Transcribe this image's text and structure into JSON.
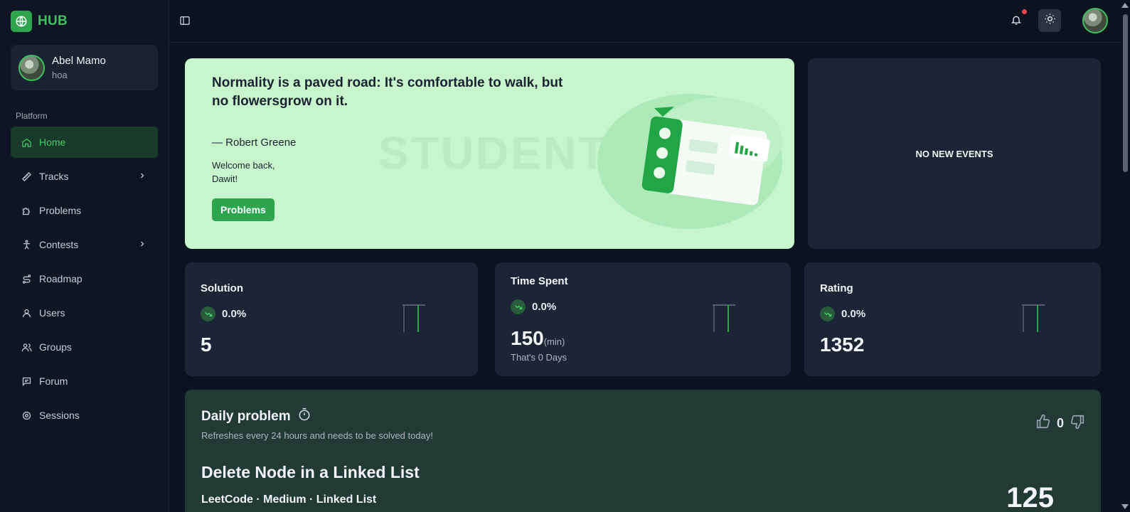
{
  "app": {
    "brand": "HUB"
  },
  "user": {
    "name": "Abel Mamo",
    "subtitle": "hoa"
  },
  "sidebar": {
    "section_label": "Platform",
    "items": [
      {
        "label": "Home",
        "icon": "home-icon",
        "active": true
      },
      {
        "label": "Tracks",
        "icon": "ruler-icon",
        "has_chevron": true
      },
      {
        "label": "Problems",
        "icon": "puzzle-icon"
      },
      {
        "label": "Contests",
        "icon": "person-icon",
        "has_chevron": true
      },
      {
        "label": "Roadmap",
        "icon": "route-icon"
      },
      {
        "label": "Users",
        "icon": "user-icon"
      },
      {
        "label": "Groups",
        "icon": "users-icon"
      },
      {
        "label": "Forum",
        "icon": "message-icon"
      },
      {
        "label": "Sessions",
        "icon": "settings-icon"
      }
    ]
  },
  "hero": {
    "quote": "Normality is a paved road: It's comfortable to walk, but no flowersgrow on it.",
    "author": "— Robert Greene",
    "welcome": "Welcome back, Dawit!",
    "button_label": "Problems",
    "watermark": "STUDENT"
  },
  "events": {
    "empty_text": "NO NEW EVENTS"
  },
  "stats": [
    {
      "title": "Solution",
      "trend": "0.0%",
      "value": "5"
    },
    {
      "title": "Time Spent",
      "trend": "0.0%",
      "value": "150",
      "unit": "(min)",
      "sub": "That's 0 Days"
    },
    {
      "title": "Rating",
      "trend": "0.0%",
      "value": "1352"
    }
  ],
  "daily": {
    "title": "Daily problem",
    "subtitle": "Refreshes every 24 hours and needs to be solved today!",
    "problem_title": "Delete Node in a Linked List",
    "meta": "LeetCode · Medium · Linked List",
    "likes": "0",
    "count": "125"
  },
  "colors": {
    "accent": "#2ea44f",
    "background": "#0b1220",
    "card": "#1c2535",
    "hero": "#c7f5cc",
    "daily": "#213a33"
  }
}
